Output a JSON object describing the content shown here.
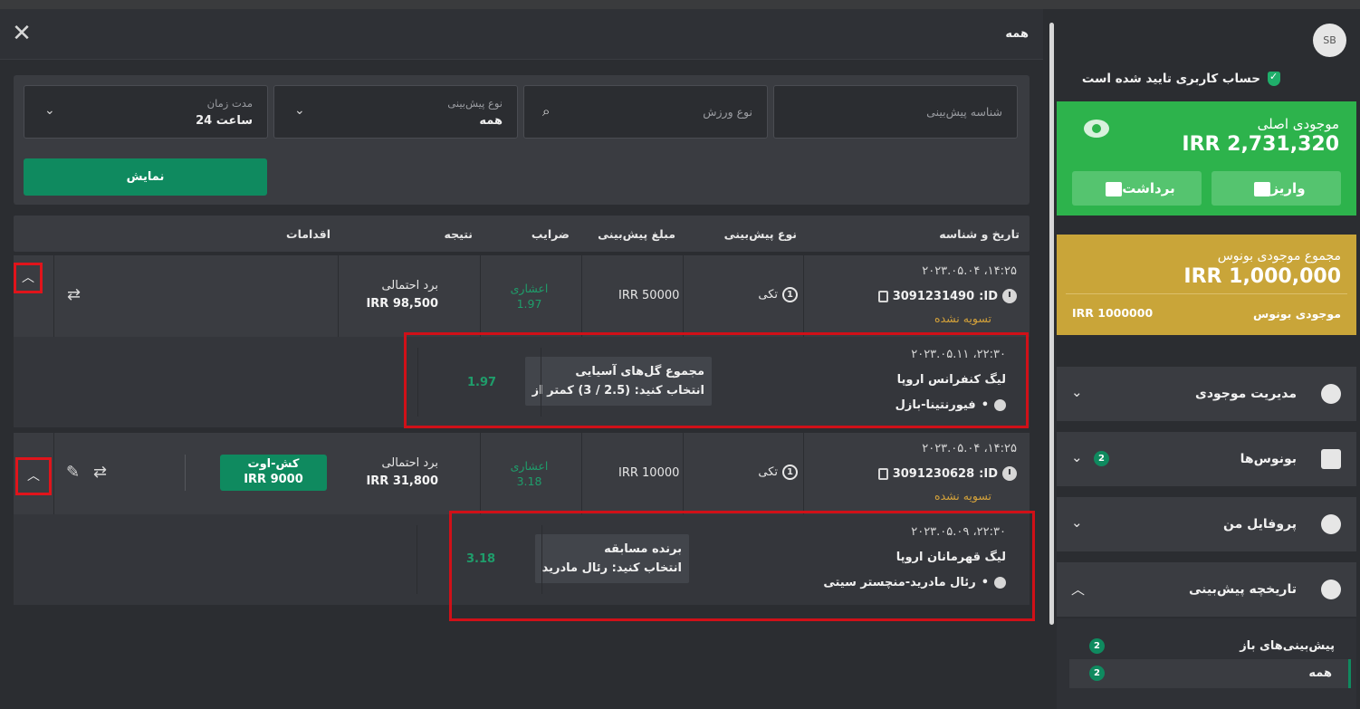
{
  "header": {
    "title": "همه",
    "close": "✕"
  },
  "filters": {
    "bet_id_placeholder": "شناسه پیش‌بینی",
    "sport_placeholder": "نوع ورزش",
    "bet_type_label": "نوع پیش‌بینی",
    "bet_type_value": "همه",
    "duration_label": "مدت زمان",
    "duration_value": "24 ساعت",
    "show_button": "نمایش"
  },
  "table": {
    "headers": [
      "تاریخ و شناسه",
      "نوع پیش‌بینی",
      "مبلغ پیش‌بینی",
      "ضرایب",
      "نتیجه",
      "اقدامات"
    ]
  },
  "bets": [
    {
      "date": "۲۰۲۳.۰۵.۰۴ ،۱۴:۲۵",
      "id_label": "ID:",
      "id": "3091231490",
      "status": "تسویه نشده",
      "type": "تکی",
      "type_num": "1",
      "amount": "IRR 50000",
      "odds_label": "اعشاری",
      "odds": "1.97",
      "result_label": "برد احتمالی",
      "result_value": "IRR 98,500",
      "detail": {
        "date": "۲۰۲۳.۰۵.۱۱ ،۲۲:۳۰",
        "league": "لیگ کنفرانس اروپا",
        "match": "فیورنتینا-بازل",
        "market": "مجموع گل‌های آسیایی",
        "selection": "انتخاب کنید: (2.5 / 3) کمتر از",
        "odds": "1.97"
      }
    },
    {
      "date": "۲۰۲۳.۰۵.۰۴ ،۱۴:۲۵",
      "id_label": "ID:",
      "id": "3091230628",
      "status": "تسویه نشده",
      "type": "تکی",
      "type_num": "1",
      "amount": "IRR 10000",
      "odds_label": "اعشاری",
      "odds": "3.18",
      "result_label": "برد احتمالی",
      "result_value": "IRR 31,800",
      "cashout_label": "کش-اوت",
      "cashout_value": "IRR 9000",
      "detail": {
        "date": "۲۰۲۳.۰۵.۰۹ ،۲۲:۳۰",
        "league": "لیگ قهرمانان اروپا",
        "match": "رئال مادرید-منچستر سیتی",
        "market": "برنده مسابقه",
        "selection": "انتخاب کنید: رئال مادرید",
        "odds": "3.18"
      }
    }
  ],
  "sidebar": {
    "avatar": "SB",
    "verified": "حساب کاربری تایید شده است",
    "main_balance": {
      "label": "موجودی اصلی",
      "amount": "IRR 2,731,320",
      "deposit": "واریز",
      "withdraw": "برداشت"
    },
    "bonus_balance": {
      "label": "مجموع موجودی بونوس",
      "amount": "IRR 1,000,000",
      "row_label": "موجودی بونوس",
      "row_value": "IRR 1000000"
    },
    "menu": [
      {
        "label": "مدیریت موجودی",
        "badge": ""
      },
      {
        "label": "بونوس‌ها",
        "badge": "2"
      },
      {
        "label": "پروفایل من",
        "badge": ""
      },
      {
        "label": "تاریخچه پیش‌بینی",
        "badge": ""
      }
    ],
    "submenu": [
      {
        "label": "پیش‌بینی‌های باز",
        "badge": "2"
      },
      {
        "label": "همه",
        "badge": "2"
      }
    ]
  },
  "colors": {
    "accent_green": "#0f8a5f",
    "balance_green": "#2db34c",
    "bonus_gold": "#c9a539",
    "highlight_red": "#d01018"
  }
}
